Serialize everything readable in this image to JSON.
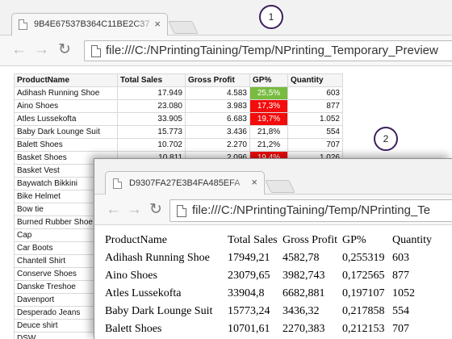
{
  "window1": {
    "tab_title": "9B4E67537B364C11BE2C37",
    "tab_close": "×",
    "nav": {
      "back": "←",
      "forward": "→",
      "reload": "↻"
    },
    "url": "file:///C:/NPrintingTaining/Temp/NPrinting_Temporary_Preview",
    "table": {
      "headers": [
        "ProductName",
        "Total Sales",
        "Gross Profit",
        "GP%",
        "Quantity"
      ],
      "rows": [
        [
          "Adihash Running Shoe",
          "17.949",
          "4.583",
          "25,5%",
          "603"
        ],
        [
          "Aino Shoes",
          "23.080",
          "3.983",
          "17,3%",
          "877"
        ],
        [
          "Atles Lussekofta",
          "33.905",
          "6.683",
          "19,7%",
          "1.052"
        ],
        [
          "Baby Dark Lounge Suit",
          "15.773",
          "3.436",
          "21,8%",
          "554"
        ],
        [
          "Balett Shoes",
          "10.702",
          "2.270",
          "21,2%",
          "707"
        ],
        [
          "Basket Shoes",
          "10.811",
          "2.096",
          "19,4%",
          "1.026"
        ],
        [
          "Basket Vest",
          "",
          "",
          "",
          ""
        ],
        [
          "Baywatch Bikkini",
          "",
          "",
          "",
          ""
        ],
        [
          "Bike Helmet",
          "",
          "",
          "",
          ""
        ],
        [
          "Bow tie",
          "",
          "",
          "",
          ""
        ],
        [
          "Burned Rubber Shoe",
          "",
          "",
          "",
          ""
        ],
        [
          "Cap",
          "",
          "",
          "",
          ""
        ],
        [
          "Car Boots",
          "",
          "",
          "",
          ""
        ],
        [
          "Chantell Shirt",
          "",
          "",
          "",
          ""
        ],
        [
          "Conserve Shoes",
          "",
          "",
          "",
          ""
        ],
        [
          "Danske Treshoe",
          "",
          "",
          "",
          ""
        ],
        [
          "Davenport",
          "",
          "",
          "",
          ""
        ],
        [
          "Desperado Jeans",
          "",
          "",
          "",
          ""
        ],
        [
          "Deuce shirt",
          "",
          "",
          "",
          ""
        ],
        [
          "DSW",
          "",
          "",
          "",
          ""
        ]
      ],
      "gp_status": [
        "high",
        "low",
        "low",
        "normal",
        "normal",
        "low"
      ]
    }
  },
  "window2": {
    "tab_title": "D9307FA27E3B4FA485EFA",
    "tab_close": "×",
    "nav": {
      "back": "←",
      "forward": "→",
      "reload": "↻"
    },
    "url": "file:///C:/NPrintingTaining/Temp/NPrinting_Te",
    "table": {
      "headers": [
        "ProductName",
        "Total Sales",
        "Gross Profit",
        "GP%",
        "Quantity"
      ],
      "rows": [
        [
          "Adihash Running Shoe",
          "17949,21",
          "4582,78",
          "0,255319",
          "603"
        ],
        [
          "Aino Shoes",
          "23079,65",
          "3982,743",
          "0,172565",
          "877"
        ],
        [
          "Atles Lussekofta",
          "33904,8",
          "6682,881",
          "0,197107",
          "1052"
        ],
        [
          "Baby Dark Lounge Suit",
          "15773,24",
          "3436,32",
          "0,217858",
          "554"
        ],
        [
          "Balett Shoes",
          "10701,61",
          "2270,383",
          "0,212153",
          "707"
        ]
      ]
    }
  },
  "callouts": [
    "1",
    "2"
  ],
  "colors": {
    "gp_high": "#78bb3f",
    "gp_low": "#f40c0c",
    "callout_border": "#3b1f5c"
  }
}
